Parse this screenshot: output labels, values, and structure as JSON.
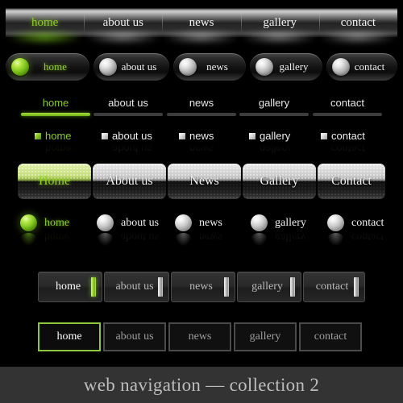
{
  "labels": [
    "home",
    "about us",
    "news",
    "gallery",
    "contact"
  ],
  "labels_caps": [
    "Home",
    "About us",
    "News",
    "Gallery",
    "Contact"
  ],
  "active_index": 0,
  "colors": {
    "accent_green": "#8ecb2a",
    "underline_green": "#8dc63f",
    "background": "#000000",
    "footer_bg": "#333333",
    "footer_text": "#bdbdbd",
    "text_light": "#f2f2f2"
  },
  "nav_metallic_bar": {
    "name": "metallic-gradient-bar",
    "items": [
      "home",
      "about us",
      "news",
      "gallery",
      "contact"
    ]
  },
  "nav_pill_buttons": {
    "name": "glossy-pill-buttons",
    "items": [
      "home",
      "about us",
      "news",
      "gallery",
      "contact"
    ],
    "orb_icon": "sphere-orb-icon"
  },
  "nav_underline": {
    "name": "underline-tabs",
    "items": [
      "home",
      "about us",
      "news",
      "gallery",
      "contact"
    ]
  },
  "nav_bullet": {
    "name": "square-bullet-links",
    "items": [
      "home",
      "about us",
      "news",
      "gallery",
      "contact"
    ],
    "bullet_icon": "square-bullet-icon"
  },
  "nav_halftone_tabs": {
    "name": "halftone-dotted-tabs",
    "items": [
      "Home",
      "About us",
      "News",
      "Gallery",
      "Contact"
    ]
  },
  "nav_sphere": {
    "name": "sphere-bullet-links",
    "items": [
      "home",
      "about us",
      "news",
      "gallery",
      "contact"
    ],
    "sphere_icon": "glossy-sphere-icon"
  },
  "nav_bar_buttons": {
    "name": "dark-buttons-with-accent-bar",
    "items": [
      "home",
      "about us",
      "news",
      "gallery",
      "contact"
    ],
    "accent_icon": "vertical-accent-bar-icon"
  },
  "nav_outline_buttons": {
    "name": "outlined-buttons",
    "items": [
      "home",
      "about us",
      "news",
      "gallery",
      "contact"
    ]
  },
  "footer": {
    "title": "web navigation — collection 2"
  }
}
